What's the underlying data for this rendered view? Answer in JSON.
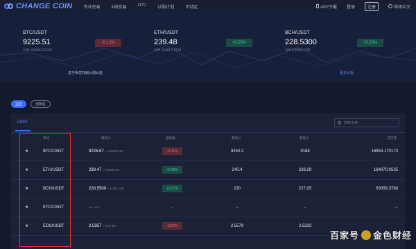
{
  "brand": {
    "name": "CHANGE COIN"
  },
  "nav": {
    "items": [
      "专业交易",
      "K线交易",
      "OTC",
      "认购计划",
      "币动定"
    ]
  },
  "top_right": {
    "app": "APP下载",
    "login": "登录",
    "register": "注册",
    "lang": "简体中文"
  },
  "tickers": [
    {
      "pair": "BTC/USDT",
      "price": "9225.51",
      "vol": "24H 16948.076241",
      "change": "-0.12%",
      "dir": "down"
    },
    {
      "pair": "ETH/USDT",
      "price": "239.48",
      "vol": "24H 164057.5119",
      "change": "+0.00%",
      "dir": "up"
    },
    {
      "pair": "BCH/USDT",
      "price": "228.5300",
      "vol": "24H 63056.2786",
      "change": "+0.26%",
      "dir": "up"
    }
  ],
  "announcement": "关于币优开启公测公告",
  "more_announcements": "更多公告",
  "zones": {
    "main": "主区",
    "innovation": "创新区"
  },
  "market_tab": "USDT",
  "search": {
    "placeholder": "搜索币种"
  },
  "table": {
    "headers": {
      "market": "市场",
      "latest": "最新价",
      "change": "涨跌幅",
      "high": "最高价",
      "low": "最低价",
      "volume": "成交量"
    },
    "rows": [
      {
        "pair": "BTC/USDT",
        "price": "9225.67",
        "cny": "≈ ¥ 65294.67",
        "change": "-0.11%",
        "dir": "down",
        "high": "9250.2",
        "low": "9188",
        "volume": "16954.170173"
      },
      {
        "pair": "ETH/USDT",
        "price": "239.47",
        "cny": "≈ ¥ 1684.84",
        "change": "+0.00%",
        "dir": "up",
        "high": "240.4",
        "low": "238.29",
        "volume": "164070.0535"
      },
      {
        "pair": "BCH/USDT",
        "price": "228.5500",
        "cny": "≈ ¥ 1617.56",
        "change": "+0.37%",
        "dir": "up",
        "high": "230",
        "low": "227.05",
        "volume": "63058.3788"
      },
      {
        "pair": "ETC/USDT",
        "price": "--",
        "cny": "≈ ¥ 0",
        "change": "--",
        "dir": "flat",
        "high": "--",
        "low": "--",
        "volume": "--"
      },
      {
        "pair": "EOS/USDT",
        "price": "2.5357",
        "cny": "≈ ¥ 17.94",
        "change": "-0.37%",
        "dir": "down",
        "high": "2.5579",
        "low": "2.5233",
        "volume": ""
      }
    ]
  },
  "watermark": {
    "left": "百家号",
    "right": "金色财经"
  },
  "colors": {
    "up": "#2ed3a2",
    "down": "#ff6b6b",
    "accent": "#3b6cff",
    "highlight_box": "#ff2d2d"
  }
}
